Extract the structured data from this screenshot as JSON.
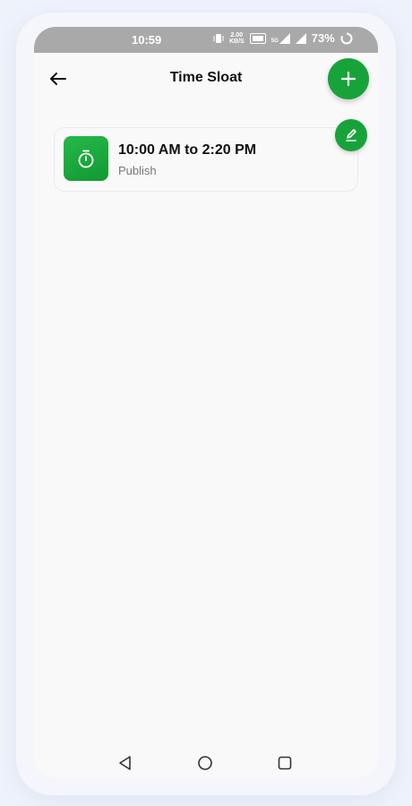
{
  "status_bar": {
    "time": "10:59",
    "net_speed_value": "2.00",
    "net_speed_unit": "KB/S",
    "network_type": "5G",
    "battery_percent": "73%"
  },
  "header": {
    "title": "Time Sloat",
    "back_icon": "arrow-left-icon",
    "add_icon": "plus-icon"
  },
  "slots": [
    {
      "time_range": "10:00 AM to 2:20 PM",
      "status": "Publish",
      "icon": "stopwatch-icon",
      "edit_icon": "pencil-icon"
    }
  ],
  "nav": {
    "back": "triangle-back-icon",
    "home": "circle-home-icon",
    "recents": "square-recents-icon"
  },
  "colors": {
    "accent": "#17a33a",
    "status_bar": "#a9a9a9",
    "background": "#f9f9f9"
  }
}
